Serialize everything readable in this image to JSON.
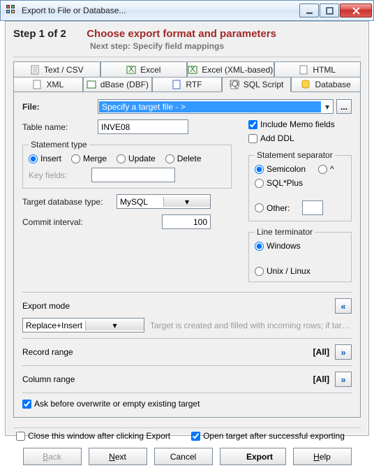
{
  "window": {
    "title": "Export to File or Database..."
  },
  "header": {
    "step": "Step 1 of 2",
    "title": "Choose export format and parameters",
    "sub": "Next step: Specify field mappings"
  },
  "tabs": {
    "row1": [
      "Text / CSV",
      "Excel",
      "Excel (XML-based)",
      "HTML"
    ],
    "row2": [
      "XML",
      "dBase (DBF)",
      "RTF",
      "SQL Script",
      "Database"
    ],
    "active": "SQL Script"
  },
  "file": {
    "label": "File:",
    "selected": "Specify a target file - >",
    "browse": "..."
  },
  "table": {
    "label": "Table name:",
    "value": "INVE08"
  },
  "memo": {
    "include_label": "Include Memo fields",
    "include": true,
    "addddl_label": "Add DDL",
    "addddl": false
  },
  "stmt_type": {
    "legend": "Statement type",
    "options": [
      "Insert",
      "Merge",
      "Update",
      "Delete"
    ],
    "value": "Insert",
    "keyfields_label": "Key fields:",
    "keyfields": ""
  },
  "stmt_sep": {
    "legend": "Statement separator",
    "options": [
      "Semicolon",
      "^",
      "SQL*Plus",
      "Other:"
    ],
    "value": "Semicolon",
    "other": ""
  },
  "target_db": {
    "label": "Target database type:",
    "value": "MySQL"
  },
  "commit": {
    "label": "Commit interval:",
    "value": "100"
  },
  "line_term": {
    "legend": "Line terminator",
    "options": [
      "Windows",
      "Unix / Linux"
    ],
    "value": "Windows"
  },
  "export_mode": {
    "label": "Export mode",
    "value": "Replace+Insert",
    "desc": "Target is created and filled with incoming rows; if target..."
  },
  "record_range": {
    "label": "Record range",
    "value": "[All]"
  },
  "column_range": {
    "label": "Column range",
    "value": "[All]"
  },
  "ask_overwrite": {
    "label": "Ask before overwrite or empty existing target",
    "value": true
  },
  "footer": {
    "close_after_label": "Close this window after clicking Export",
    "close_after": false,
    "open_target_label": "Open target after successful exporting",
    "open_target": true
  },
  "buttons": {
    "back": "Back",
    "next": "Next",
    "cancel": "Cancel",
    "export": "Export",
    "help": "Help"
  }
}
